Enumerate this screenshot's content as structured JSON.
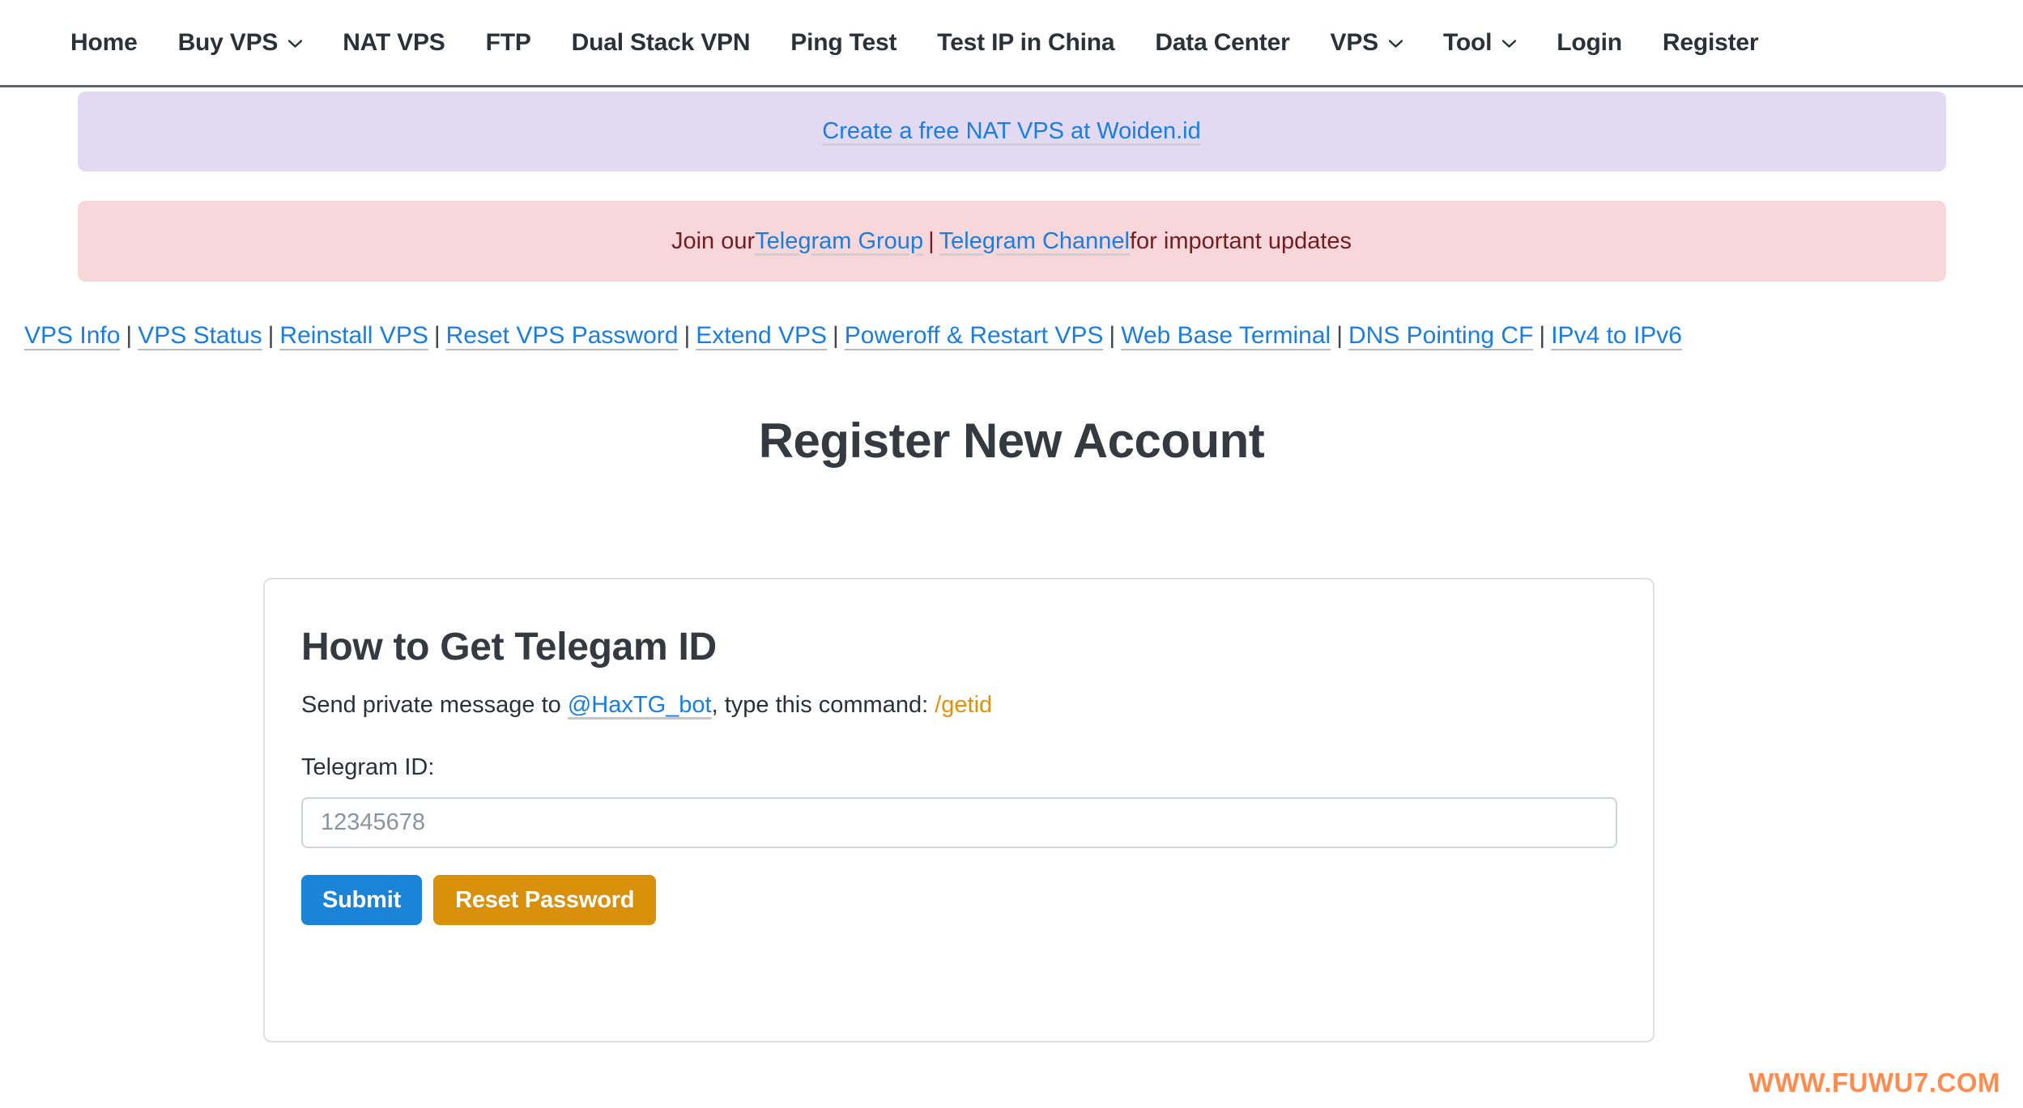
{
  "nav": {
    "items": [
      {
        "label": "Home",
        "caret": false
      },
      {
        "label": "Buy VPS",
        "caret": true,
        "caret_icon": "chevron-down-icon"
      },
      {
        "label": "NAT VPS",
        "caret": false
      },
      {
        "label": "FTP",
        "caret": false
      },
      {
        "label": "Dual Stack VPN",
        "caret": false
      },
      {
        "label": "Ping Test",
        "caret": false
      },
      {
        "label": "Test IP in China",
        "caret": false
      },
      {
        "label": "Data Center",
        "caret": false
      },
      {
        "label": "VPS",
        "caret": true,
        "caret_icon": "chevron-down-icon"
      },
      {
        "label": "Tool",
        "caret": true,
        "caret_icon": "chevron-down-icon"
      },
      {
        "label": "Login",
        "caret": false
      },
      {
        "label": "Register",
        "caret": false
      }
    ]
  },
  "alerts": {
    "purple": {
      "link_text": "Create a free NAT VPS at Woiden.id",
      "bg_color": "#e2d9f3"
    },
    "pink": {
      "prefix": "Join our ",
      "link1": "Telegram Group",
      "separator": " | ",
      "link2": "Telegram Channel",
      "suffix": " for important updates",
      "bg_color": "#f8d7da",
      "text_color": "#721c24"
    }
  },
  "linkbar": {
    "separator": "|",
    "links": [
      "VPS Info",
      "VPS Status",
      "Reinstall VPS",
      "Reset VPS Password",
      "Extend VPS",
      "Poweroff & Restart VPS",
      "Web Base Terminal",
      "DNS Pointing CF",
      "IPv4 to IPv6"
    ]
  },
  "page": {
    "title": "Register New Account"
  },
  "card": {
    "title": "How to Get Telegam ID",
    "desc_prefix": "Send private message to ",
    "bot_handle": "@HaxTG_bot",
    "desc_middle": ", type this command: ",
    "command": "/getid",
    "field_label": "Telegram ID:",
    "input_value": "",
    "input_placeholder": "12345678",
    "submit_label": "Submit",
    "reset_label": "Reset Password",
    "submit_color": "#1a84d8",
    "reset_color": "#d9900b"
  },
  "watermark": {
    "text": "WWW.FUWU7.COM",
    "color": "#fd8c51"
  }
}
